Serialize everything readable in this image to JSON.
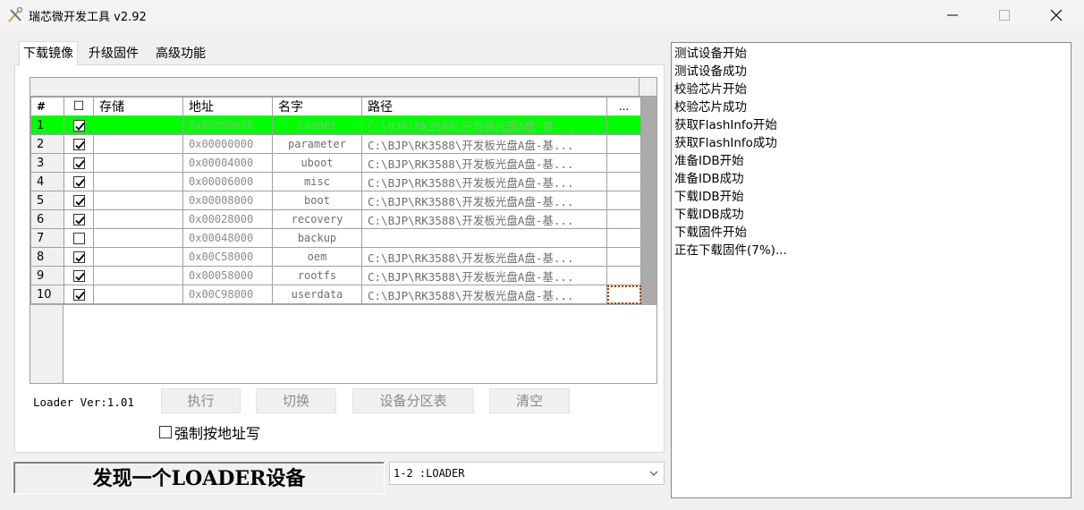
{
  "window": {
    "title": "瑞芯微开发工具 v2.92"
  },
  "tabs": [
    {
      "label": "下载镜像",
      "active": true
    },
    {
      "label": "升级固件",
      "active": false
    },
    {
      "label": "高级功能",
      "active": false
    }
  ],
  "grid": {
    "headers": {
      "index": "#",
      "check": "☐",
      "storage": "存储",
      "address": "地址",
      "name": "名字",
      "path": "路径",
      "more": "..."
    },
    "rows": [
      {
        "index": "1",
        "checked": true,
        "storage": "",
        "address": "0x00000000",
        "name": "loader",
        "path": "C:\\BJP\\RK3588\\开发板光盘A盘-基...",
        "selected": true
      },
      {
        "index": "2",
        "checked": true,
        "storage": "",
        "address": "0x00000000",
        "name": "parameter",
        "path": "C:\\BJP\\RK3588\\开发板光盘A盘-基..."
      },
      {
        "index": "3",
        "checked": true,
        "storage": "",
        "address": "0x00004000",
        "name": "uboot",
        "path": "C:\\BJP\\RK3588\\开发板光盘A盘-基..."
      },
      {
        "index": "4",
        "checked": true,
        "storage": "",
        "address": "0x00006000",
        "name": "misc",
        "path": "C:\\BJP\\RK3588\\开发板光盘A盘-基..."
      },
      {
        "index": "5",
        "checked": true,
        "storage": "",
        "address": "0x00008000",
        "name": "boot",
        "path": "C:\\BJP\\RK3588\\开发板光盘A盘-基..."
      },
      {
        "index": "6",
        "checked": true,
        "storage": "",
        "address": "0x00028000",
        "name": "recovery",
        "path": "C:\\BJP\\RK3588\\开发板光盘A盘-基..."
      },
      {
        "index": "7",
        "checked": false,
        "storage": "",
        "address": "0x00048000",
        "name": "backup",
        "path": ""
      },
      {
        "index": "8",
        "checked": true,
        "storage": "",
        "address": "0x00C58000",
        "name": "oem",
        "path": "C:\\BJP\\RK3588\\开发板光盘A盘-基..."
      },
      {
        "index": "9",
        "checked": true,
        "storage": "",
        "address": "0x00058000",
        "name": "rootfs",
        "path": "C:\\BJP\\RK3588\\开发板光盘A盘-基..."
      },
      {
        "index": "10",
        "checked": true,
        "storage": "",
        "address": "0x00C98000",
        "name": "userdata",
        "path": "C:\\BJP\\RK3588\\开发板光盘A盘-基...",
        "focus": true
      }
    ]
  },
  "controls": {
    "loader_ver": "Loader Ver:1.01",
    "execute": "执行",
    "switch": "切换",
    "partition_table": "设备分区表",
    "clear": "清空",
    "force_address_write": "强制按地址写"
  },
  "status": {
    "text": "发现一个LOADER设备"
  },
  "device_select": {
    "value": "1-2 :LOADER"
  },
  "log": [
    "测试设备开始",
    "测试设备成功",
    "校验芯片开始",
    "校验芯片成功",
    "获取FlashInfo开始",
    "获取FlashInfo成功",
    "准备IDB开始",
    "准备IDB成功",
    "下载IDB开始",
    "下载IDB成功",
    "下载固件开始",
    "正在下载固件(7%)..."
  ],
  "colors": {
    "selected_row": "#00ff00",
    "window_bg": "#f0f0f0"
  }
}
